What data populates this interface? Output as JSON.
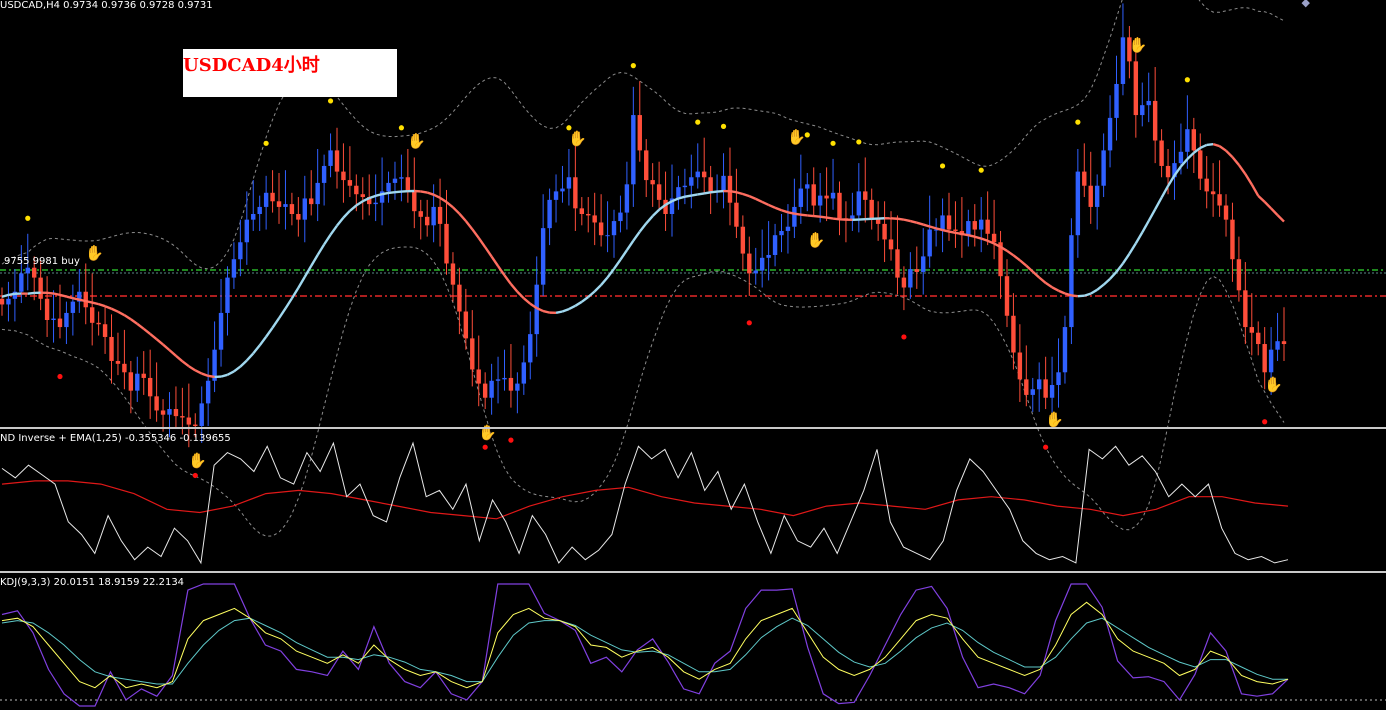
{
  "header": {
    "symbol_info": "USDCAD,H4  0.9734 0.9736 0.9728 0.9731",
    "watermark_title": "USDCAD4小时",
    "order_line_label": "9755 9981 buy",
    "corner_mark": "◆"
  },
  "colors": {
    "background": "#000000",
    "bull_candle": "#3060ff",
    "bear_candle": "#ff4e3a",
    "bands": "#8c8c8c",
    "ma_up": "#a0d8ef",
    "ma_down": "#ff6e60",
    "green_line": "#28b428",
    "red_line": "#e62828",
    "ind1_main": "#e8e8e8",
    "ind1_signal": "#e01818",
    "kdj_k": "#ffff60",
    "kdj_d": "#5ec8c8",
    "kdj_j": "#8040e0",
    "fractal_up": "#ffe000",
    "fractal_down": "#ff1010",
    "hand_sell": "#ff3030",
    "hand_buy": "#ffd800"
  },
  "indicator1": {
    "label": "ND Inverse + EMA(1,25) -0.355346 -0.139655"
  },
  "indicator2": {
    "label": "KDJ(9,3,3) 20.0151 18.9159 22.2134"
  },
  "chart_data": [
    {
      "type": "candlestick",
      "title": "USDCAD,H4",
      "ohlc_current": [
        0.9734,
        0.9736,
        0.9728,
        0.9731
      ],
      "price_range": [
        0.97,
        1.0
      ],
      "closes": [
        0.9786,
        0.979,
        0.9795,
        0.9808,
        0.9812,
        0.9805,
        0.979,
        0.9775,
        0.9776,
        0.977,
        0.978,
        0.9788,
        0.9795,
        0.9784,
        0.9773,
        0.9772,
        0.9763,
        0.9746,
        0.9744,
        0.9738,
        0.9725,
        0.9737,
        0.9734,
        0.9721,
        0.9711,
        0.9708,
        0.9712,
        0.9707,
        0.9706,
        0.9701,
        0.97,
        0.9716,
        0.9732,
        0.9754,
        0.978,
        0.9805,
        0.9818,
        0.983,
        0.9846,
        0.985,
        0.9855,
        0.9865,
        0.9859,
        0.9855,
        0.9857,
        0.985,
        0.9846,
        0.9861,
        0.9857,
        0.9872,
        0.9884,
        0.9895,
        0.988,
        0.9874,
        0.987,
        0.9864,
        0.9862,
        0.9857,
        0.9858,
        0.9866,
        0.9872,
        0.9875,
        0.9876,
        0.9866,
        0.9852,
        0.9848,
        0.9842,
        0.9855,
        0.9843,
        0.9815,
        0.98,
        0.9781,
        0.9762,
        0.974,
        0.973,
        0.972,
        0.9732,
        0.9733,
        0.9734,
        0.9725,
        0.973,
        0.9745,
        0.9765,
        0.98,
        0.984,
        0.986,
        0.9866,
        0.9868,
        0.9876,
        0.9854,
        0.985,
        0.9849,
        0.9844,
        0.9835,
        0.9835,
        0.9845,
        0.9851,
        0.9871,
        0.992,
        0.9895,
        0.9874,
        0.9871,
        0.986,
        0.985,
        0.9861,
        0.9869,
        0.987,
        0.9876,
        0.988,
        0.9876,
        0.9866,
        0.9866,
        0.9877,
        0.9858,
        0.9841,
        0.9822,
        0.9808,
        0.981,
        0.9819,
        0.9821,
        0.9835,
        0.9838,
        0.9841,
        0.9855,
        0.9868,
        0.9871,
        0.9856,
        0.9863,
        0.9861,
        0.9865,
        0.9847,
        0.9846,
        0.9849,
        0.9866,
        0.986,
        0.9847,
        0.9843,
        0.9832,
        0.9825,
        0.9805,
        0.9798,
        0.9811,
        0.9809,
        0.982,
        0.9839,
        0.9839,
        0.9849,
        0.9839,
        0.9838,
        0.9835,
        0.9845,
        0.9839,
        0.9846,
        0.9836,
        0.983,
        0.9806,
        0.9778,
        0.9752,
        0.9733,
        0.9722,
        0.9726,
        0.9733,
        0.972,
        0.9729,
        0.9738,
        0.977,
        0.9835,
        0.988,
        0.987,
        0.9855,
        0.987,
        0.9895,
        0.9918,
        0.9942,
        0.9975,
        0.9958,
        0.992,
        0.9927,
        0.993,
        0.9902,
        0.9884,
        0.9876,
        0.9886,
        0.9894,
        0.991,
        0.9895,
        0.9875,
        0.9866,
        0.9864,
        0.9856,
        0.9846,
        0.9818,
        0.9796,
        0.977,
        0.9766,
        0.9758,
        0.9738,
        0.9754,
        0.976,
        0.9758
      ]
    },
    {
      "type": "line",
      "title": "ND Inverse + EMA(1,25)",
      "values_current": [
        -0.355346,
        -0.139655
      ],
      "series": [
        {
          "name": "ND Inverse",
          "values": [
            0.55,
            0.4,
            0.6,
            0.45,
            0.3,
            -0.3,
            -0.5,
            -0.8,
            -0.2,
            -0.6,
            -0.9,
            -0.7,
            -0.85,
            -0.4,
            -0.6,
            -0.95,
            0.6,
            0.8,
            0.7,
            0.5,
            0.9,
            0.4,
            0.3,
            0.8,
            0.5,
            0.95,
            0.1,
            0.3,
            -0.2,
            -0.3,
            0.4,
            0.95,
            0.1,
            0.2,
            -0.1,
            0.3,
            -0.6,
            0.05,
            -0.3,
            -0.8,
            -0.2,
            -0.5,
            -0.95,
            -0.7,
            -0.9,
            -0.75,
            -0.5,
            0.3,
            0.9,
            0.7,
            0.85,
            0.4,
            0.8,
            0.2,
            0.5,
            -0.1,
            0.3,
            -0.3,
            -0.8,
            -0.2,
            -0.6,
            -0.7,
            -0.4,
            -0.8,
            -0.3,
            0.2,
            0.85,
            -0.3,
            -0.7,
            -0.8,
            -0.9,
            -0.6,
            0.2,
            0.7,
            0.5,
            0.2,
            -0.1,
            -0.6,
            -0.8,
            -0.9,
            -0.85,
            -0.95,
            0.85,
            0.7,
            0.9,
            0.6,
            0.75,
            0.5,
            0.1,
            0.3,
            0.1,
            0.3,
            -0.4,
            -0.8,
            -0.9,
            -0.85,
            -0.95,
            -0.9
          ]
        },
        {
          "name": "EMA(1,25)",
          "values": [
            0.3,
            0.35,
            0.35,
            0.3,
            0.15,
            -0.1,
            -0.15,
            -0.05,
            0.15,
            0.2,
            0.15,
            0.05,
            -0.05,
            -0.15,
            -0.2,
            -0.25,
            -0.05,
            0.1,
            0.2,
            0.25,
            0.1,
            0.0,
            -0.05,
            -0.1,
            -0.2,
            -0.05,
            0.0,
            -0.05,
            -0.1,
            0.05,
            0.1,
            0.05,
            -0.05,
            -0.1,
            -0.2,
            -0.1,
            0.1,
            0.1,
            0.0,
            -0.05
          ]
        }
      ]
    },
    {
      "type": "line",
      "title": "KDJ(9,3,3)",
      "values_current": [
        20.0151,
        18.9159,
        22.2134
      ],
      "series": [
        {
          "name": "K",
          "values": [
            70,
            72,
            65,
            50,
            35,
            20,
            15,
            25,
            15,
            18,
            15,
            20,
            55,
            70,
            75,
            80,
            72,
            60,
            55,
            45,
            40,
            35,
            42,
            35,
            50,
            38,
            30,
            25,
            28,
            20,
            15,
            20,
            60,
            75,
            80,
            72,
            70,
            65,
            50,
            48,
            40,
            45,
            48,
            40,
            28,
            22,
            30,
            35,
            55,
            70,
            75,
            80,
            60,
            40,
            30,
            25,
            30,
            40,
            55,
            70,
            75,
            72,
            55,
            40,
            35,
            30,
            25,
            30,
            50,
            75,
            85,
            75,
            55,
            45,
            40,
            35,
            25,
            30,
            45,
            40,
            25,
            20,
            18,
            22
          ]
        },
        {
          "name": "D",
          "values": [
            68,
            70,
            68,
            60,
            50,
            38,
            28,
            24,
            22,
            20,
            18,
            18,
            35,
            50,
            62,
            70,
            72,
            66,
            60,
            52,
            46,
            40,
            40,
            38,
            42,
            40,
            36,
            30,
            28,
            25,
            20,
            20,
            40,
            58,
            68,
            70,
            70,
            66,
            58,
            52,
            46,
            44,
            45,
            42,
            35,
            28,
            28,
            30,
            42,
            56,
            65,
            72,
            66,
            55,
            44,
            36,
            32,
            35,
            45,
            56,
            64,
            68,
            62,
            52,
            44,
            38,
            32,
            32,
            40,
            55,
            68,
            72,
            64,
            56,
            48,
            42,
            36,
            32,
            38,
            38,
            32,
            26,
            22,
            22
          ]
        },
        {
          "name": "J",
          "values": [
            75,
            78,
            60,
            30,
            10,
            0,
            0,
            28,
            5,
            14,
            8,
            25,
            95,
            100,
            100,
            100,
            72,
            50,
            45,
            30,
            28,
            25,
            45,
            30,
            65,
            35,
            20,
            15,
            28,
            10,
            5,
            20,
            100,
            100,
            100,
            76,
            70,
            62,
            35,
            40,
            28,
            46,
            55,
            36,
            14,
            10,
            35,
            45,
            80,
            95,
            95,
            96,
            48,
            10,
            2,
            3,
            25,
            50,
            75,
            95,
            98,
            80,
            40,
            15,
            18,
            15,
            10,
            25,
            70,
            100,
            100,
            81,
            37,
            23,
            24,
            20,
            5,
            26,
            60,
            45,
            10,
            8,
            10,
            22
          ]
        }
      ]
    }
  ]
}
